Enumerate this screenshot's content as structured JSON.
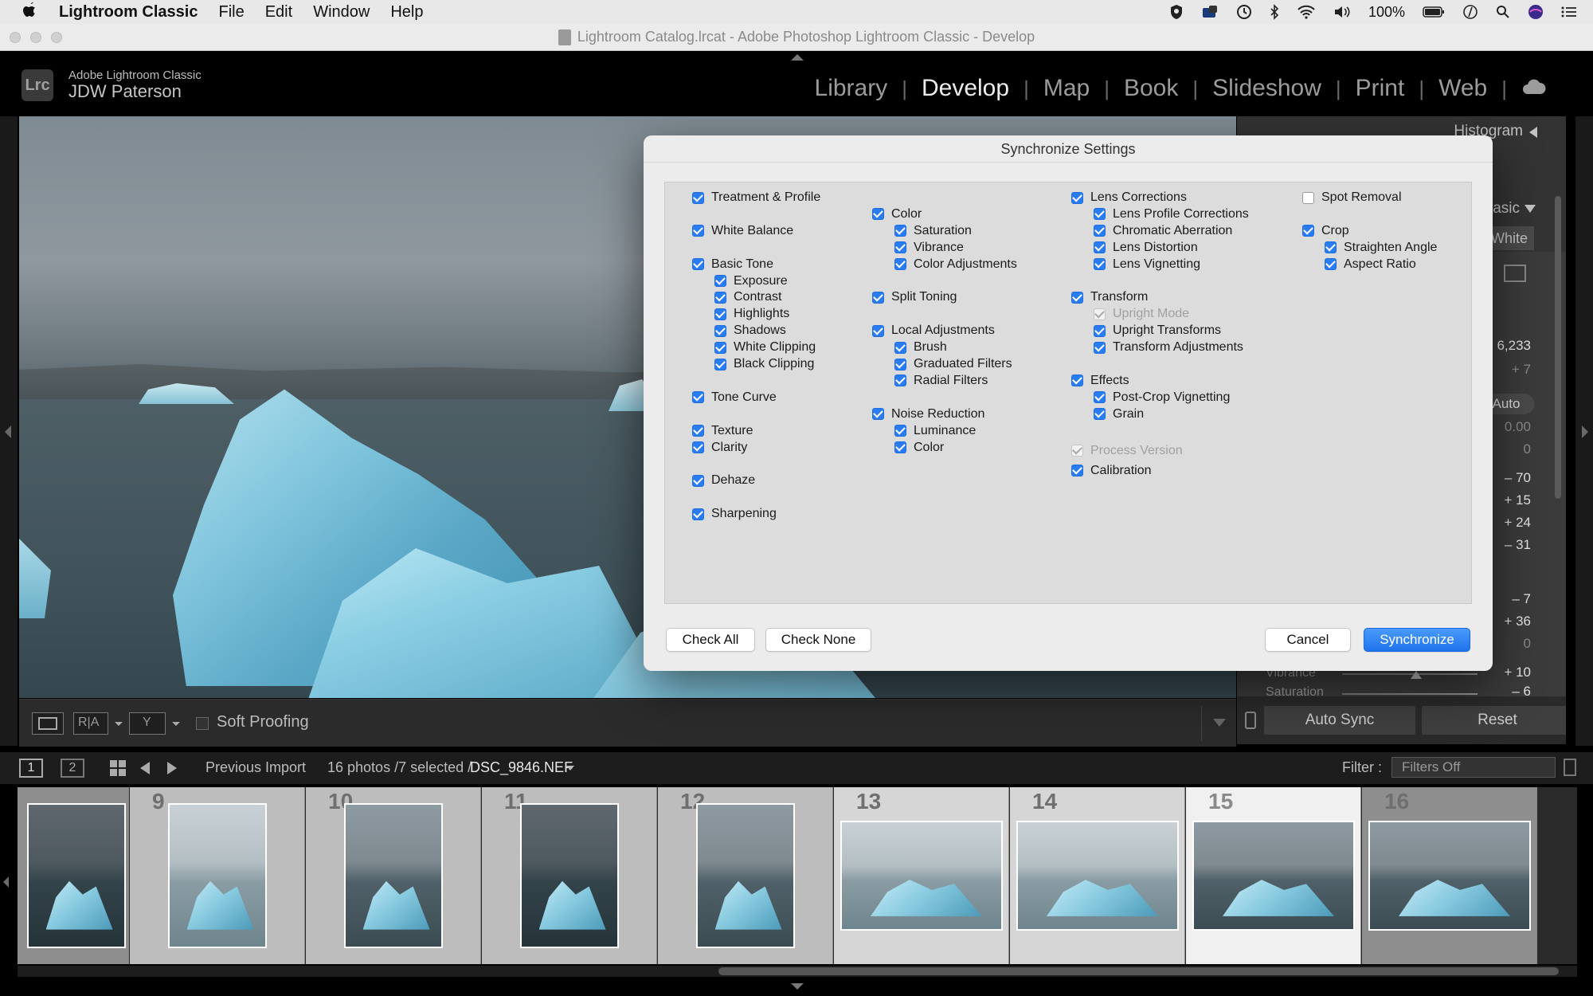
{
  "menubar": {
    "app_name": "Lightroom Classic",
    "menus": [
      "File",
      "Edit",
      "Window",
      "Help"
    ],
    "battery": "100%"
  },
  "window": {
    "title": "Lightroom Catalog.lrcat - Adobe Photoshop Lightroom Classic - Develop"
  },
  "identity": {
    "badge": "Lrc",
    "product": "Adobe Lightroom Classic",
    "user": "JDW Paterson"
  },
  "modules": {
    "library": "Library",
    "develop": "Develop",
    "map": "Map",
    "book": "Book",
    "slideshow": "Slideshow",
    "print": "Print",
    "web": "Web"
  },
  "right_panel": {
    "histogram_label": "Histogram",
    "basic_label": "Basic",
    "bw_label": "& White",
    "temp_value": "6,233",
    "tint_value": "+ 7",
    "auto_label": "Auto",
    "exposure_value": "0.00",
    "contrast_value": "0",
    "highlights_value": "– 70",
    "shadows_value": "+ 15",
    "whites_value": "+ 24",
    "blacks_value": "– 31",
    "texture_value": "– 7",
    "clarity_value": "+ 36",
    "dehaze_value": "0",
    "vibrance_label": "Vibrance",
    "vibrance_value": "+ 10",
    "saturation_label": "Saturation",
    "saturation_value": "– 6",
    "auto_sync": "Auto Sync",
    "reset": "Reset"
  },
  "toolbar": {
    "soft_proofing": "Soft Proofing"
  },
  "filmstrip_header": {
    "view1": "1",
    "view2": "2",
    "source": "Previous Import",
    "count": "16 photos /7 selected /",
    "filename": "DSC_9846.NEF",
    "filter_label": "Filter :",
    "filter_value": "Filters Off"
  },
  "filmstrip": {
    "cells": [
      {
        "index": "",
        "orient": "portrait",
        "tone": "dark",
        "state": "dim"
      },
      {
        "index": "9",
        "orient": "portrait",
        "tone": "light",
        "state": "normal"
      },
      {
        "index": "10",
        "orient": "portrait",
        "tone": "mid",
        "state": "normal"
      },
      {
        "index": "11",
        "orient": "portrait",
        "tone": "dark",
        "state": "normal"
      },
      {
        "index": "12",
        "orient": "portrait",
        "tone": "mid",
        "state": "normal"
      },
      {
        "index": "13",
        "orient": "landscape",
        "tone": "light",
        "state": "sel"
      },
      {
        "index": "14",
        "orient": "landscape",
        "tone": "light",
        "state": "sel"
      },
      {
        "index": "15",
        "orient": "landscape",
        "tone": "mid",
        "state": "primary"
      },
      {
        "index": "16",
        "orient": "landscape",
        "tone": "mid",
        "state": "dim"
      }
    ]
  },
  "dialog": {
    "title": "Synchronize Settings",
    "columns": [
      [
        {
          "label": "Treatment & Profile",
          "state": "on",
          "indent": 0,
          "row": 0
        },
        {
          "label": "White Balance",
          "state": "on",
          "indent": 0,
          "row": 2
        },
        {
          "label": "Basic Tone",
          "state": "on",
          "indent": 0,
          "row": 4
        },
        {
          "label": "Exposure",
          "state": "on",
          "indent": 1,
          "row": 5
        },
        {
          "label": "Contrast",
          "state": "on",
          "indent": 1,
          "row": 6
        },
        {
          "label": "Highlights",
          "state": "on",
          "indent": 1,
          "row": 7
        },
        {
          "label": "Shadows",
          "state": "on",
          "indent": 1,
          "row": 8
        },
        {
          "label": "White Clipping",
          "state": "on",
          "indent": 1,
          "row": 9
        },
        {
          "label": "Black Clipping",
          "state": "on",
          "indent": 1,
          "row": 10
        },
        {
          "label": "Tone Curve",
          "state": "on",
          "indent": 0,
          "row": 12
        },
        {
          "label": "Texture",
          "state": "on",
          "indent": 0,
          "row": 14
        },
        {
          "label": "Clarity",
          "state": "on",
          "indent": 0,
          "row": 15
        },
        {
          "label": "Dehaze",
          "state": "on",
          "indent": 0,
          "row": 17
        },
        {
          "label": "Sharpening",
          "state": "on",
          "indent": 0,
          "row": 19
        }
      ],
      [
        {
          "label": "Color",
          "state": "on",
          "indent": 0,
          "row": 1
        },
        {
          "label": "Saturation",
          "state": "on",
          "indent": 1,
          "row": 2
        },
        {
          "label": "Vibrance",
          "state": "on",
          "indent": 1,
          "row": 3
        },
        {
          "label": "Color Adjustments",
          "state": "on",
          "indent": 1,
          "row": 4
        },
        {
          "label": "Split Toning",
          "state": "on",
          "indent": 0,
          "row": 6
        },
        {
          "label": "Local Adjustments",
          "state": "on",
          "indent": 0,
          "row": 8
        },
        {
          "label": "Brush",
          "state": "on",
          "indent": 1,
          "row": 9
        },
        {
          "label": "Graduated Filters",
          "state": "on",
          "indent": 1,
          "row": 10
        },
        {
          "label": "Radial Filters",
          "state": "on",
          "indent": 1,
          "row": 11
        },
        {
          "label": "Noise Reduction",
          "state": "on",
          "indent": 0,
          "row": 13
        },
        {
          "label": "Luminance",
          "state": "on",
          "indent": 1,
          "row": 14
        },
        {
          "label": "Color",
          "state": "on",
          "indent": 1,
          "row": 15
        }
      ],
      [
        {
          "label": "Lens Corrections",
          "state": "on",
          "indent": 0,
          "row": 0
        },
        {
          "label": "Lens Profile Corrections",
          "state": "on",
          "indent": 1,
          "row": 1
        },
        {
          "label": "Chromatic Aberration",
          "state": "on",
          "indent": 1,
          "row": 2
        },
        {
          "label": "Lens Distortion",
          "state": "on",
          "indent": 1,
          "row": 3
        },
        {
          "label": "Lens Vignetting",
          "state": "on",
          "indent": 1,
          "row": 4
        },
        {
          "label": "Transform",
          "state": "on",
          "indent": 0,
          "row": 6
        },
        {
          "label": "Upright Mode",
          "state": "disabled",
          "indent": 1,
          "row": 7
        },
        {
          "label": "Upright Transforms",
          "state": "on",
          "indent": 1,
          "row": 8
        },
        {
          "label": "Transform Adjustments",
          "state": "on",
          "indent": 1,
          "row": 9
        },
        {
          "label": "Effects",
          "state": "on",
          "indent": 0,
          "row": 11
        },
        {
          "label": "Post-Crop Vignetting",
          "state": "on",
          "indent": 1,
          "row": 12
        },
        {
          "label": "Grain",
          "state": "on",
          "indent": 1,
          "row": 13
        },
        {
          "label": "Process Version",
          "state": "disabled",
          "indent": 0,
          "row": 15.2
        },
        {
          "label": "Calibration",
          "state": "on",
          "indent": 0,
          "row": 16.4
        }
      ],
      [
        {
          "label": "Spot Removal",
          "state": "off",
          "indent": 0,
          "row": 0
        },
        {
          "label": "Crop",
          "state": "on",
          "indent": 0,
          "row": 2
        },
        {
          "label": "Straighten Angle",
          "state": "on",
          "indent": 1,
          "row": 3
        },
        {
          "label": "Aspect Ratio",
          "state": "on",
          "indent": 1,
          "row": 4
        }
      ]
    ],
    "check_all": "Check All",
    "check_none": "Check None",
    "cancel": "Cancel",
    "synchronize": "Synchronize"
  }
}
